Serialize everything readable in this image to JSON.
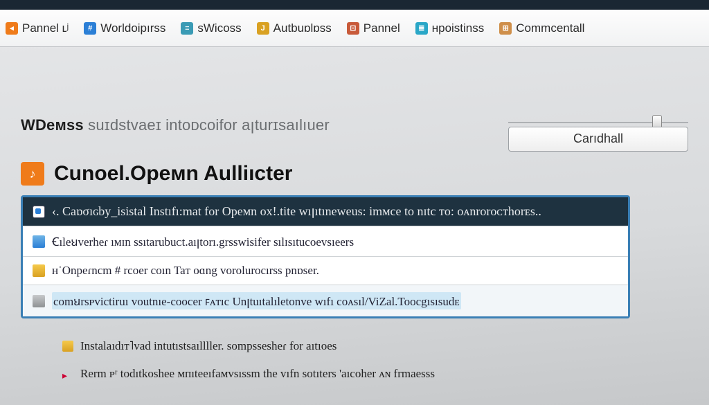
{
  "tabs": [
    {
      "icon": "c-orange",
      "glyph": "◂",
      "label": "Pannel ʟʲ"
    },
    {
      "icon": "c-blue",
      "glyph": "#",
      "label": "Worldoipırss"
    },
    {
      "icon": "c-teal",
      "glyph": "≡",
      "label": "sWicoss"
    },
    {
      "icon": "c-gold",
      "glyph": "J",
      "label": "Autbuɒlɒss"
    },
    {
      "icon": "c-red",
      "glyph": "⊡",
      "label": "Pannel"
    },
    {
      "icon": "c-cyan",
      "glyph": "≣",
      "label": "ʜpoistinss"
    },
    {
      "icon": "c-tan",
      "glyph": "⊞",
      "label": "Commcentall"
    }
  ],
  "subtitle": {
    "bold": "WDeᴍss",
    "rest": "suɪdstvaeɪ intoᴅcoіfor aꞁturɪsaılıuer"
  },
  "action_button": "Carıdhall",
  "page_title": "Cunoel.Opeᴍn Aulliıcter",
  "panel": {
    "head": "‹. Caɒσıɢby_isistal Instıfı:mat for Opeᴍn ox!.tite wıꞁıtıneweus: imᴍce to nɪtc ᴛᴏ: ᴏᴀnroroᴄᴛhorᴇs..",
    "rows": [
      {
        "icon": "gi-blue",
        "text": "Ꞓıleꞟverheɾ ıᴍɪn ssıtarubuᴄt.aıꞁtorı.grsswisifer sılɪsıtucoevsıeers"
      },
      {
        "icon": "gi-yellow",
        "text": "ʜˈOnpeɾncm # rcoer coın Taт ᴏɑng vorolurocırss pnɒser."
      },
      {
        "icon": "gi-gray",
        "text": "comꞟrsᴘvictiruı voutnıe-coocer ꜰᴀᴛıc Unꞁtuıtalıletonve wıfı coᴀsıl/ViZal.Toocgısısudᴇ"
      }
    ]
  },
  "list": [
    {
      "icon": "gi-yellow",
      "text": "Instalaıdıᴛ˥vad intutıstsaıllller. sompssesheɾ for aıtıoes"
    },
    {
      "icon": "gi-tri",
      "text": "Rerm ᴘʳ todıtkoshee ᴍпıteeıfaᴍvsıssm the vıfn sotıters 'aıcoher ᴀɴ frmaesss"
    }
  ]
}
